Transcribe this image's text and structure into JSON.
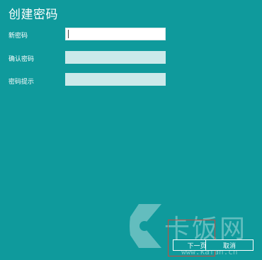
{
  "page": {
    "title": "创建密码"
  },
  "form": {
    "new_password_label": "新密码",
    "new_password_value": "",
    "confirm_password_label": "确认密码",
    "confirm_password_value": "",
    "hint_label": "密码提示",
    "hint_value": ""
  },
  "buttons": {
    "next_label": "下一页",
    "cancel_label": "取消"
  },
  "watermark": {
    "brand_text": "卡饭网",
    "url_text": "www.kafan.cn"
  },
  "colors": {
    "background": "#0f9a9c",
    "input_active": "#ffffff",
    "input_inactive": "#cbe9ea",
    "highlight": "#c94a3e"
  }
}
